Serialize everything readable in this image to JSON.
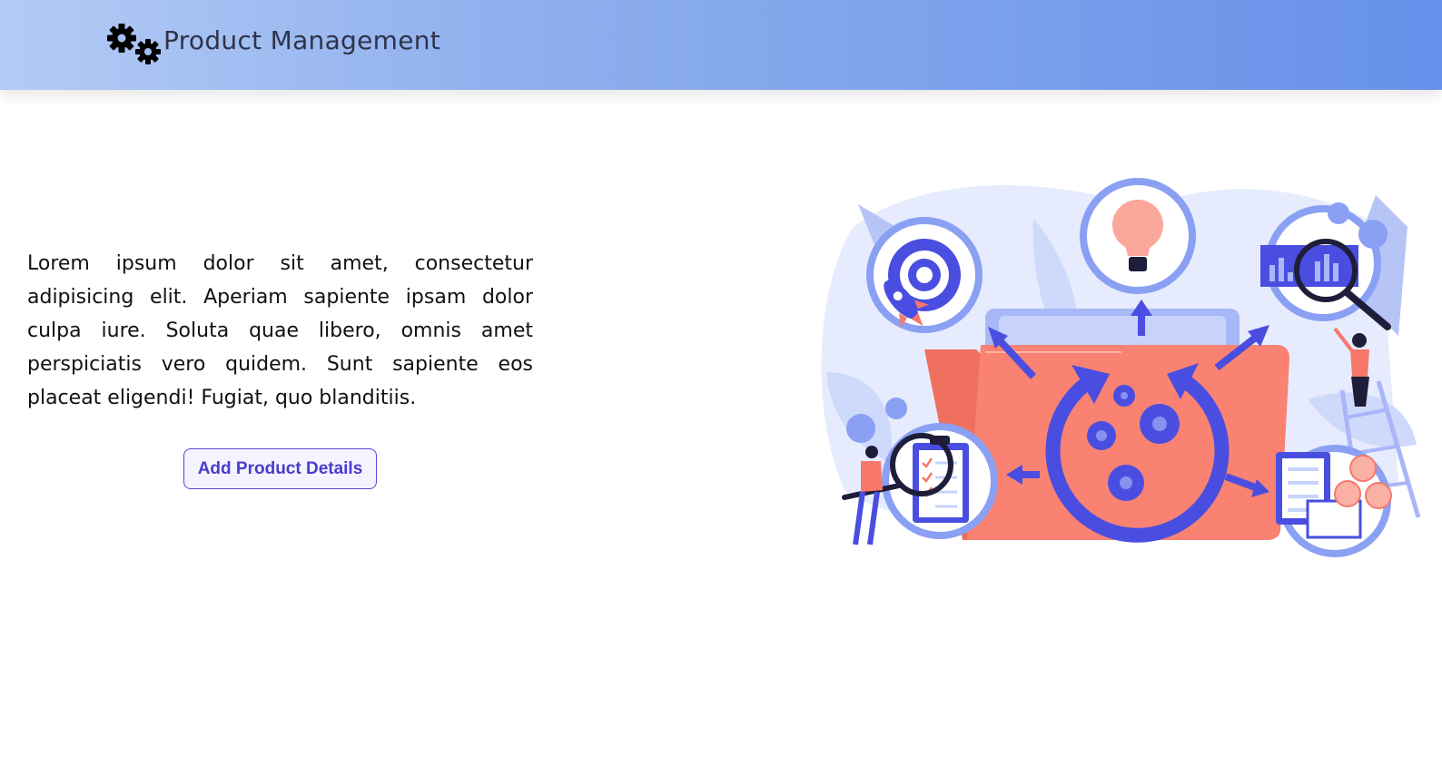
{
  "header": {
    "brand_icon": "gears-icon",
    "title": "Product Management"
  },
  "main": {
    "intro_text": "Lorem ipsum dolor sit amet, consectetur adipisicing elit. Aperiam sapiente ipsam dolor culpa iure. Soluta quae libero, omnis amet perspiciatis vero quidem. Sunt sapiente eos placeat eligendi! Fugiat, quo blanditiis.",
    "add_button_label": "Add Product Details"
  },
  "colors": {
    "header_gradient_start": "#b3cbf5",
    "header_gradient_end": "#6690ea",
    "button_text": "#4b3bcc",
    "button_border": "#5b47d6",
    "illustration_coral": "#f7786b",
    "illustration_blue": "#4a4ee0"
  }
}
